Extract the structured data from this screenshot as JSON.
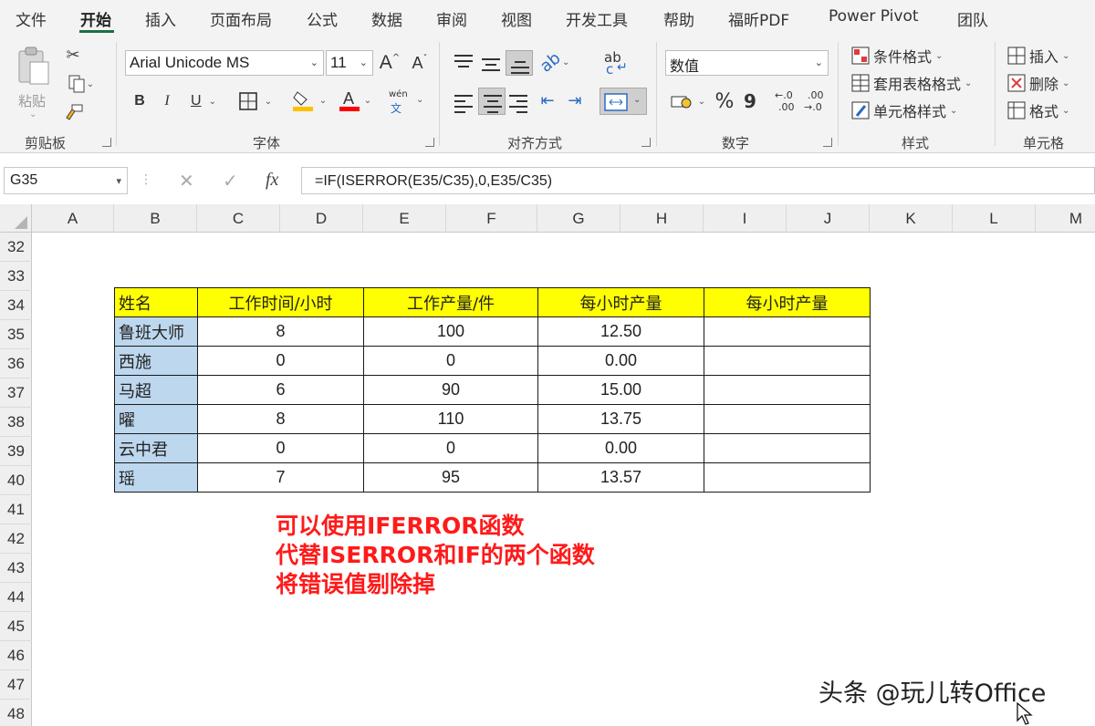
{
  "menu": {
    "tabs": [
      "文件",
      "开始",
      "插入",
      "页面布局",
      "公式",
      "数据",
      "审阅",
      "视图",
      "开发工具",
      "帮助",
      "福昕PDF",
      "Power Pivot",
      "团队"
    ],
    "active": "开始"
  },
  "ribbon": {
    "clipboard": {
      "paste_label": "粘贴",
      "group_label": "剪贴板"
    },
    "font": {
      "font_name": "Arial Unicode MS",
      "font_size": "11",
      "grow": "A",
      "shrink": "A",
      "bold": "B",
      "italic": "I",
      "underline": "U",
      "phonetic_top": "wén",
      "phonetic_bottom": "文",
      "group_label": "字体",
      "fill_color": "#ffc000",
      "font_color": "#ff0000"
    },
    "alignment": {
      "wrap_top": "ab",
      "wrap_bottom": "c",
      "group_label": "对齐方式"
    },
    "number": {
      "format": "数值",
      "percent": "%",
      "comma": "9",
      "inc_dec_a": "←.0",
      "inc_dec_b": ".00",
      "dec_dec_a": ".00",
      "dec_dec_b": "→.0",
      "group_label": "数字"
    },
    "styles": {
      "conditional": "条件格式",
      "table_format": "套用表格格式",
      "cell_style": "单元格样式",
      "group_label": "样式"
    },
    "cells": {
      "insert": "插入",
      "delete": "删除",
      "format": "格式",
      "group_label": "单元格"
    }
  },
  "formula_bar": {
    "name_box": "G35",
    "formula": "=IF(ISERROR(E35/C35),0,E35/C35)",
    "fx": "fx"
  },
  "sheet": {
    "columns": [
      "A",
      "B",
      "C",
      "D",
      "E",
      "F",
      "G",
      "H",
      "I",
      "J",
      "K",
      "L",
      "M"
    ],
    "rows": [
      "32",
      "33",
      "34",
      "35",
      "36",
      "37",
      "38",
      "39",
      "40",
      "41",
      "42",
      "43",
      "44",
      "45",
      "46",
      "47",
      "48"
    ],
    "table": {
      "headers": [
        "姓名",
        "工作时间/小时",
        "工作产量/件",
        "每小时产量",
        "每小时产量"
      ],
      "rows": [
        [
          "鲁班大师",
          "8",
          "100",
          "12.50",
          ""
        ],
        [
          "西施",
          "0",
          "0",
          "0.00",
          ""
        ],
        [
          "马超",
          "6",
          "90",
          "15.00",
          ""
        ],
        [
          "曜",
          "8",
          "110",
          "13.75",
          ""
        ],
        [
          "云中君",
          "0",
          "0",
          "0.00",
          ""
        ],
        [
          "瑶",
          "7",
          "95",
          "13.57",
          ""
        ]
      ],
      "header_color": "#ffff00",
      "name_color": "#bdd7ee"
    },
    "note_lines": [
      "可以使用IFERROR函数",
      "代替ISERROR和IF的两个函数",
      "将错误值剔除掉"
    ],
    "note_color": "#ff1a1a"
  },
  "watermark": "头条 @玩儿转Office"
}
